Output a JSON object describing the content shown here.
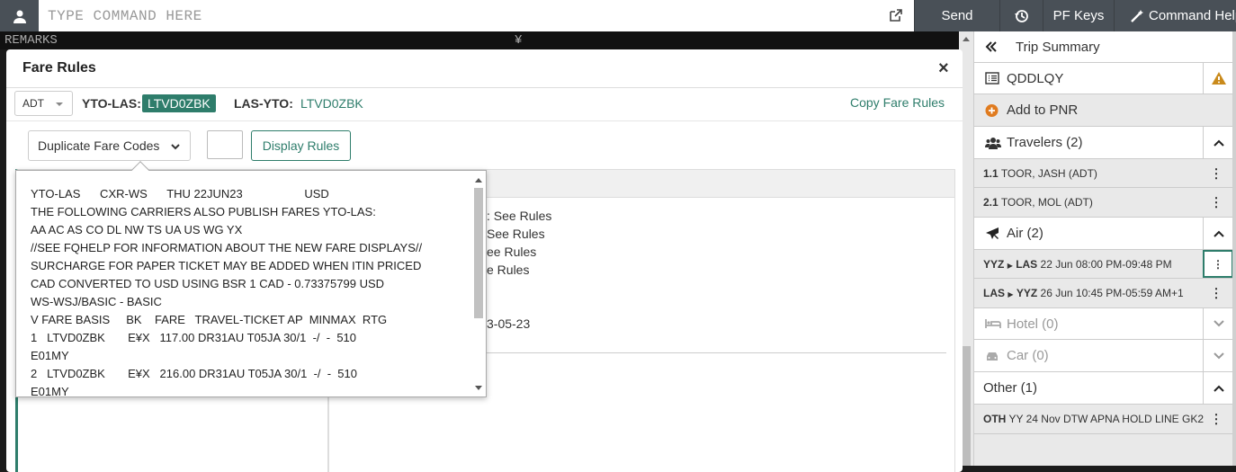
{
  "topbar": {
    "command_placeholder": "TYPE COMMAND HERE",
    "send_label": "Send",
    "pf_keys_label": "PF Keys",
    "command_helper_label": "Command Helper"
  },
  "terminal": {
    "line_left": "REMARKS",
    "line_mid": "¥"
  },
  "modal": {
    "title": "Fare Rules",
    "close": "×",
    "pax_type": "ADT",
    "segment1_label": "YTO-LAS:",
    "segment1_fare": "LTVD0ZBK",
    "segment2_label": "LAS-YTO:",
    "segment2_fare": "LTVD0ZBK",
    "copy_label": "Copy Fare Rules",
    "duplicate_label": "Duplicate Fare Codes",
    "display_rules_label": "Display Rules",
    "rule_lines": [
      ": See Rules",
      "See Rules",
      "ee Rules",
      "e Rules",
      "3-05-23"
    ],
    "tooltip_lines": [
      "YTO-LAS      CXR-WS      THU 22JUN23                   USD",
      "THE FOLLOWING CARRIERS ALSO PUBLISH FARES YTO-LAS:",
      "AA AC AS CO DL NW TS UA US WG YX",
      "//SEE FQHELP FOR INFORMATION ABOUT THE NEW FARE DISPLAYS//",
      "SURCHARGE FOR PAPER TICKET MAY BE ADDED WHEN ITIN PRICED",
      "CAD CONVERTED TO USD USING BSR 1 CAD - 0.73375799 USD",
      "WS-WSJ/BASIC - BASIC",
      "V FARE BASIS     BK    FARE   TRAVEL-TICKET AP  MINMAX  RTG",
      "1   LTVD0ZBK       E¥X   117.00 DR31AU T05JA 30/1  -/  -  510",
      "E01MY",
      "2   LTVD0ZBK       E¥X   216.00 DR31AU T05JA 30/1  -/  -  510",
      "E01MY"
    ]
  },
  "sidebar": {
    "trip_summary": "Trip Summary",
    "pnr": "QDDLQY",
    "add_to_pnr": "Add to PNR",
    "travelers_header": "Travelers (2)",
    "travelers": [
      {
        "num": "1.1",
        "name": "TOOR, JASH (ADT)"
      },
      {
        "num": "2.1",
        "name": "TOOR, MOL (ADT)"
      }
    ],
    "air_header": "Air (2)",
    "air_segments": [
      {
        "from": "YYZ",
        "to": "LAS",
        "detail": "22 Jun 08:00 PM-09:48 PM"
      },
      {
        "from": "LAS",
        "to": "YYZ",
        "detail": "26 Jun 10:45 PM-05:59 AM+1"
      }
    ],
    "hotel_header": "Hotel (0)",
    "car_header": "Car (0)",
    "other_header": "Other (1)",
    "other_item_code": "OTH",
    "other_item_detail": "YY 24 Nov DTW APNA HOLD LINE GK2"
  },
  "colors": {
    "accent": "#2e7d6b",
    "toolbar": "#495057",
    "warning": "#c98a1b"
  }
}
